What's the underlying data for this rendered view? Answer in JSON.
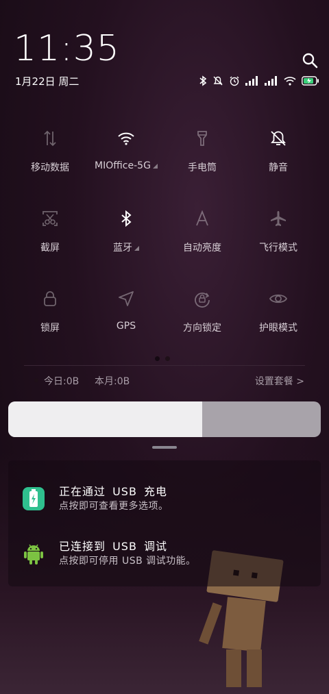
{
  "header": {
    "time": "11:35",
    "date": "1月22日 周二"
  },
  "status_icons": [
    "bluetooth-icon",
    "mute-icon",
    "alarm-icon",
    "signal-icon",
    "signal-icon",
    "wifi-icon",
    "battery-charging-icon"
  ],
  "tiles": [
    {
      "label": "移动数据",
      "icon": "mobile-data-icon",
      "on": false
    },
    {
      "label": "MIOffice-5G",
      "icon": "wifi-icon",
      "on": true
    },
    {
      "label": "手电筒",
      "icon": "flashlight-icon",
      "on": false
    },
    {
      "label": "静音",
      "icon": "mute-icon",
      "on": true
    },
    {
      "label": "截屏",
      "icon": "screenshot-icon",
      "on": false
    },
    {
      "label": "蓝牙",
      "icon": "bluetooth-icon",
      "on": true
    },
    {
      "label": "自动亮度",
      "icon": "auto-brightness-icon",
      "on": false
    },
    {
      "label": "飞行模式",
      "icon": "airplane-icon",
      "on": false
    },
    {
      "label": "锁屏",
      "icon": "lock-icon",
      "on": false
    },
    {
      "label": "GPS",
      "icon": "location-icon",
      "on": false
    },
    {
      "label": "方向锁定",
      "icon": "rotation-lock-icon",
      "on": false
    },
    {
      "label": "护眼模式",
      "icon": "eye-icon",
      "on": false
    }
  ],
  "usage": {
    "today": "今日:0B",
    "month": "本月:0B",
    "plan": "设置套餐 >"
  },
  "brightness": {
    "level": 0.62
  },
  "notifications": [
    {
      "title": "正在通过 USB 充电",
      "subtitle": "点按即可查看更多选项。",
      "icon": "usb-charging-icon"
    },
    {
      "title": "已连接到 USB 调试",
      "subtitle": "点按即可停用 USB 调试功能。",
      "icon": "android-icon"
    }
  ],
  "colors": {
    "accent_green": "#3ad07a",
    "usb_icon_green": "#2fbf8e",
    "android_green": "#7cc242"
  }
}
